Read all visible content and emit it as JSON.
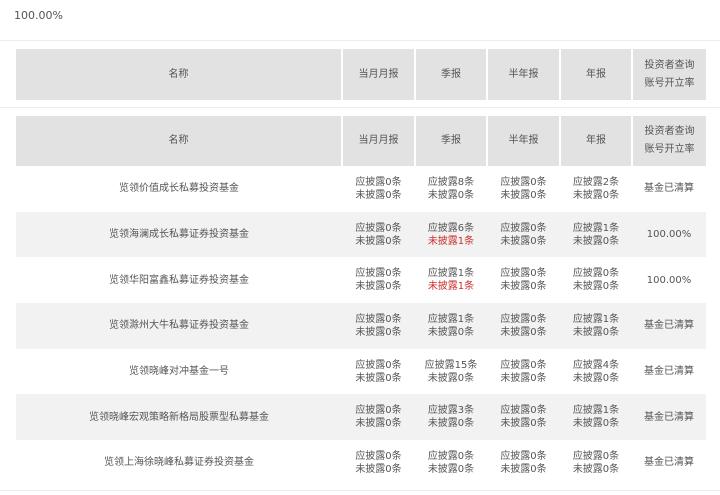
{
  "top_value": "100.00%",
  "headers": [
    "名称",
    "当月月报",
    "季报",
    "半年报",
    "年报",
    "投资者查询",
    "账号开立率"
  ],
  "rows": [
    {
      "name": "览领价值成长私募投资基金",
      "monthly": [
        "应披露0条",
        "未披露0条"
      ],
      "quarterly": [
        "应披露8条",
        "未披露0条"
      ],
      "semiannual": [
        "应披露0条",
        "未披露0条"
      ],
      "annual": [
        "应披露2条",
        "未披露0条"
      ],
      "rate": "基金已清算"
    },
    {
      "name": "览领海澜成长私募证券投资基金",
      "monthly": [
        "应披露0条",
        "未披露0条"
      ],
      "quarterly": [
        "应披露6条",
        "未披露1条"
      ],
      "semiannual": [
        "应披露0条",
        "未披露0条"
      ],
      "annual": [
        "应披露1条",
        "未披露0条"
      ],
      "rate": "100.00%"
    },
    {
      "name": "览领华阳富鑫私募证券投资基金",
      "monthly": [
        "应披露0条",
        "未披露0条"
      ],
      "quarterly": [
        "应披露1条",
        "未披露1条"
      ],
      "semiannual": [
        "应披露0条",
        "未披露0条"
      ],
      "annual": [
        "应披露0条",
        "未披露0条"
      ],
      "rate": "100.00%"
    },
    {
      "name": "览领滁州大牛私募证券投资基金",
      "monthly": [
        "应披露0条",
        "未披露0条"
      ],
      "quarterly": [
        "应披露1条",
        "未披露0条"
      ],
      "semiannual": [
        "应披露0条",
        "未披露0条"
      ],
      "annual": [
        "应披露1条",
        "未披露0条"
      ],
      "rate": "基金已清算"
    },
    {
      "name": "览领晓峰对冲基金一号",
      "monthly": [
        "应披露0条",
        "未披露0条"
      ],
      "quarterly": [
        "应披露15条",
        "未披露0条"
      ],
      "semiannual": [
        "应披露0条",
        "未披露0条"
      ],
      "annual": [
        "应披露4条",
        "未披露0条"
      ],
      "rate": "基金已清算"
    },
    {
      "name": "览领晓峰宏观策略新格局股票型私募基金",
      "monthly": [
        "应披露0条",
        "未披露0条"
      ],
      "quarterly": [
        "应披露3条",
        "未披露0条"
      ],
      "semiannual": [
        "应披露0条",
        "未披露0条"
      ],
      "annual": [
        "应披露1条",
        "未披露0条"
      ],
      "rate": "基金已清算"
    },
    {
      "name": "览领上海徐晓峰私募证券投资基金",
      "monthly": [
        "应披露0条",
        "未披露0条"
      ],
      "quarterly": [
        "应披露0条",
        "未披露0条"
      ],
      "semiannual": [
        "应披露0条",
        "未披露0条"
      ],
      "annual": [
        "应披露0条",
        "未披露0条"
      ],
      "rate": "基金已清算"
    }
  ],
  "colors": {
    "header_bg": "#e2e2e2",
    "alt_row_bg": "#f2f2f2",
    "alert_red": "#c9302c",
    "text": "#555555"
  }
}
